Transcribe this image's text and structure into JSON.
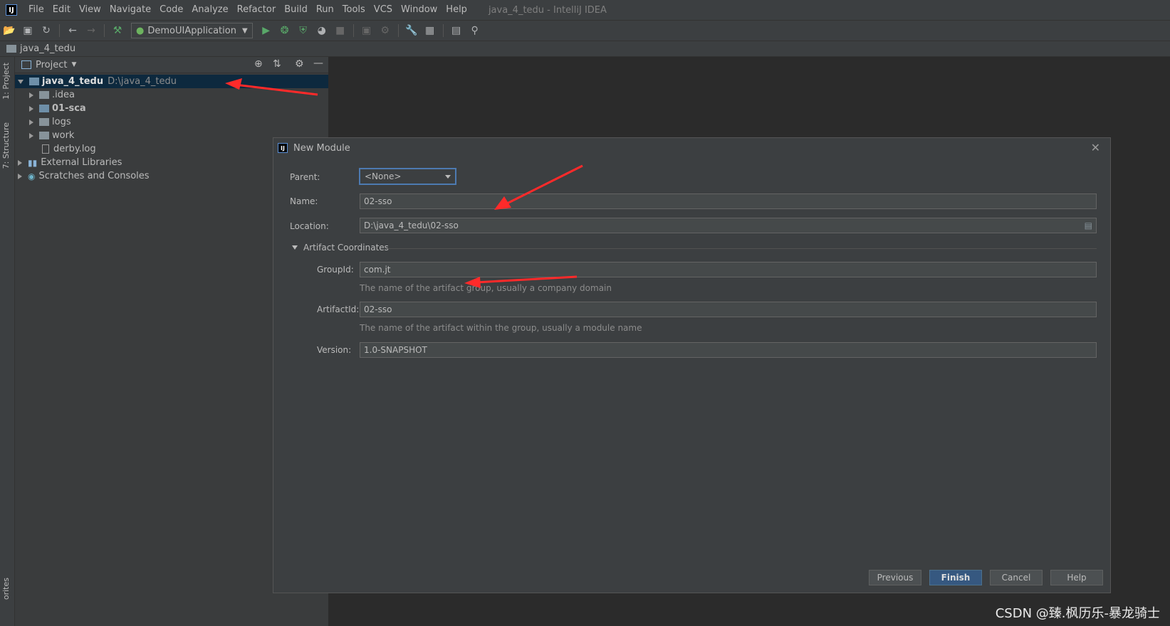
{
  "menubar": {
    "items": [
      "File",
      "Edit",
      "View",
      "Navigate",
      "Code",
      "Analyze",
      "Refactor",
      "Build",
      "Run",
      "Tools",
      "VCS",
      "Window",
      "Help"
    ],
    "window_title": "java_4_tedu - IntelliJ IDEA"
  },
  "toolbar": {
    "run_config": "DemoUIApplication"
  },
  "breadcrumb": {
    "project": "java_4_tedu"
  },
  "side_tabs": {
    "project": "1: Project",
    "structure": "7: Structure",
    "favorites": "orites"
  },
  "project_panel": {
    "title": "Project",
    "root": {
      "name": "java_4_tedu",
      "path": "D:\\java_4_tedu"
    },
    "children": [
      ".idea",
      "01-sca",
      "logs",
      "work",
      "derby.log"
    ],
    "external_libraries": "External Libraries",
    "scratches": "Scratches and Consoles"
  },
  "dialog": {
    "title": "New Module",
    "parent_label": "Parent:",
    "parent_value": "<None>",
    "name_label": "Name:",
    "name_value": "02-sso",
    "location_label": "Location:",
    "location_value": "D:\\java_4_tedu\\02-sso",
    "section_title": "Artifact Coordinates",
    "groupid_label": "GroupId:",
    "groupid_value": "com.jt",
    "groupid_hint": "The name of the artifact group, usually a company domain",
    "artifactid_label": "ArtifactId:",
    "artifactid_value": "02-sso",
    "artifactid_hint": "The name of the artifact within the group, usually a module name",
    "version_label": "Version:",
    "version_value": "1.0-SNAPSHOT",
    "buttons": {
      "previous": "Previous",
      "finish": "Finish",
      "cancel": "Cancel",
      "help": "Help"
    }
  },
  "watermark": "CSDN @臻.枫历乐-暴龙骑士",
  "colors": {
    "accent": "#4d7ab1",
    "selection": "#0d293e",
    "annotation": "#ff2a2a"
  }
}
